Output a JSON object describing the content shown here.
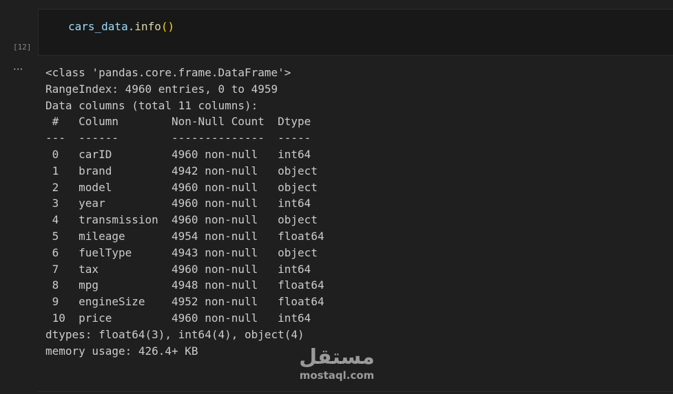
{
  "cell": {
    "execution_count": "[12]",
    "code": {
      "var": "cars_data",
      "dot": ".",
      "func": "info",
      "parens": "()"
    }
  },
  "output": {
    "menu_label": "···",
    "lines": [
      "<class 'pandas.core.frame.DataFrame'>",
      "RangeIndex: 4960 entries, 0 to 4959",
      "Data columns (total 11 columns):",
      " #   Column        Non-Null Count  Dtype  ",
      "---  ------        --------------  -----  ",
      " 0   carID         4960 non-null   int64  ",
      " 1   brand         4942 non-null   object ",
      " 2   model         4960 non-null   object ",
      " 3   year          4960 non-null   int64  ",
      " 4   transmission  4960 non-null   object ",
      " 5   mileage       4954 non-null   float64",
      " 6   fuelType      4943 non-null   object ",
      " 7   tax           4960 non-null   int64  ",
      " 8   mpg           4948 non-null   float64",
      " 9   engineSize    4952 non-null   float64",
      " 10  price         4960 non-null   int64  ",
      "dtypes: float64(3), int64(4), object(4)",
      "memory usage: 426.4+ KB"
    ]
  },
  "watermark": {
    "arabic": "مستقل",
    "latin": "mostaql.com"
  }
}
